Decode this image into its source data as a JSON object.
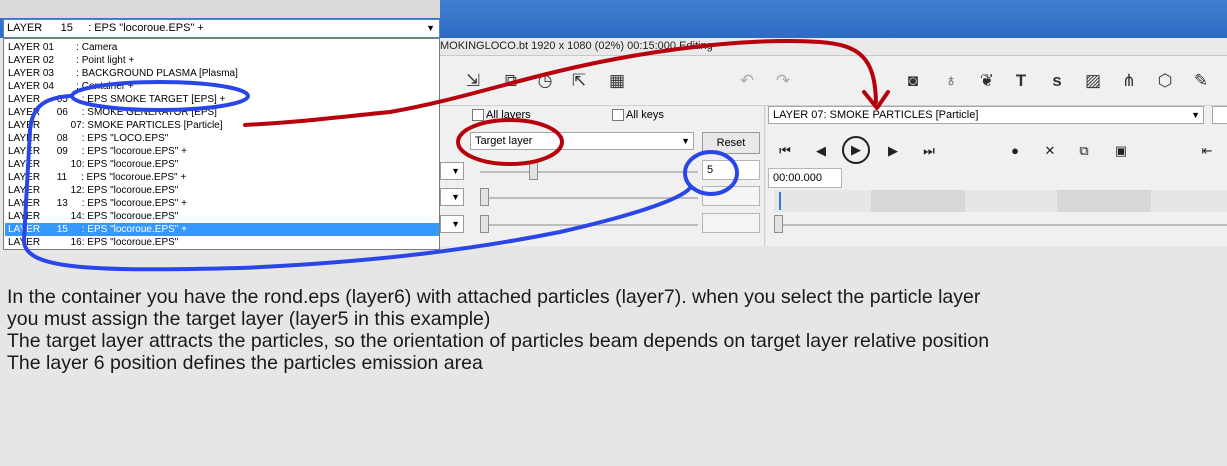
{
  "window": {
    "title": "MOKINGLOCO.bt 1920 x 1080 (02%) 00:15:000 Editing"
  },
  "layer_dropdown": {
    "selected": "LAYER      15     : EPS \"locoroue.EPS\" +",
    "items": [
      "LAYER 01        : Camera",
      "LAYER 02        : Point light +",
      "LAYER 03        : BACKGROUND PLASMA [Plasma]",
      "LAYER 04        : Container +",
      "LAYER      05     : EPS SMOKE TARGET [EPS] +",
      "LAYER      06     : SMOKE GENERATOR [EPS]",
      "LAYER           07: SMOKE PARTICLES [Particle]",
      "LAYER      08     : EPS \"LOCO.EPS\"",
      "LAYER      09     : EPS \"locoroue.EPS\" +",
      "LAYER           10: EPS \"locoroue.EPS\"",
      "LAYER      11     : EPS \"locoroue.EPS\" +",
      "LAYER           12: EPS \"locoroue.EPS\"",
      "LAYER      13     : EPS \"locoroue.EPS\" +",
      "LAYER           14: EPS \"locoroue.EPS\"",
      "LAYER      15     : EPS \"locoroue.EPS\" +",
      "LAYER           16: EPS \"locoroue.EPS\""
    ],
    "selected_index": 14
  },
  "toolbar": {
    "left_icons": [
      "import-icon",
      "export-icon",
      "clock-icon",
      "folder-open-icon",
      "film-icon"
    ],
    "undo_icon": "undo-icon",
    "redo_icon": "redo-icon",
    "right_icons": [
      "camera-icon",
      "light-bulb-icon",
      "particles-icon",
      "text-icon",
      "s-icon",
      "image-icon",
      "nodes-icon",
      "cube-icon",
      "brush-icon"
    ],
    "text_glyph": "T",
    "s_glyph": "s"
  },
  "mid_panel": {
    "all_layers_label": "All layers",
    "all_keys_label": "All keys",
    "target_select": "Target layer",
    "reset_label": "Reset",
    "target_value": "5"
  },
  "right_panel": {
    "layer_select": "LAYER        07: SMOKE PARTICLES [Particle]",
    "timecode": "00:00.000",
    "transport": [
      "go-start-icon",
      "step-back-icon",
      "play-icon",
      "step-forward-icon",
      "go-end-icon"
    ],
    "tools": [
      "record-icon",
      "close-icon",
      "copy-icon",
      "paste-icon"
    ]
  },
  "description": [
    "In the container you have the rond.eps (layer6) with attached particles (layer7). when you select the particle layer",
    "you must assign the target layer (layer5 in this example)",
    "The target layer attracts the particles, so the orientation of particles beam depends on target layer relative position",
    "The layer 6 position defines the particles emission area"
  ],
  "colors": {
    "annotation_red": "#b8000c",
    "annotation_blue": "#2b46e8",
    "selection": "#3399ff",
    "titlebar_blue": "#3a78cc"
  }
}
